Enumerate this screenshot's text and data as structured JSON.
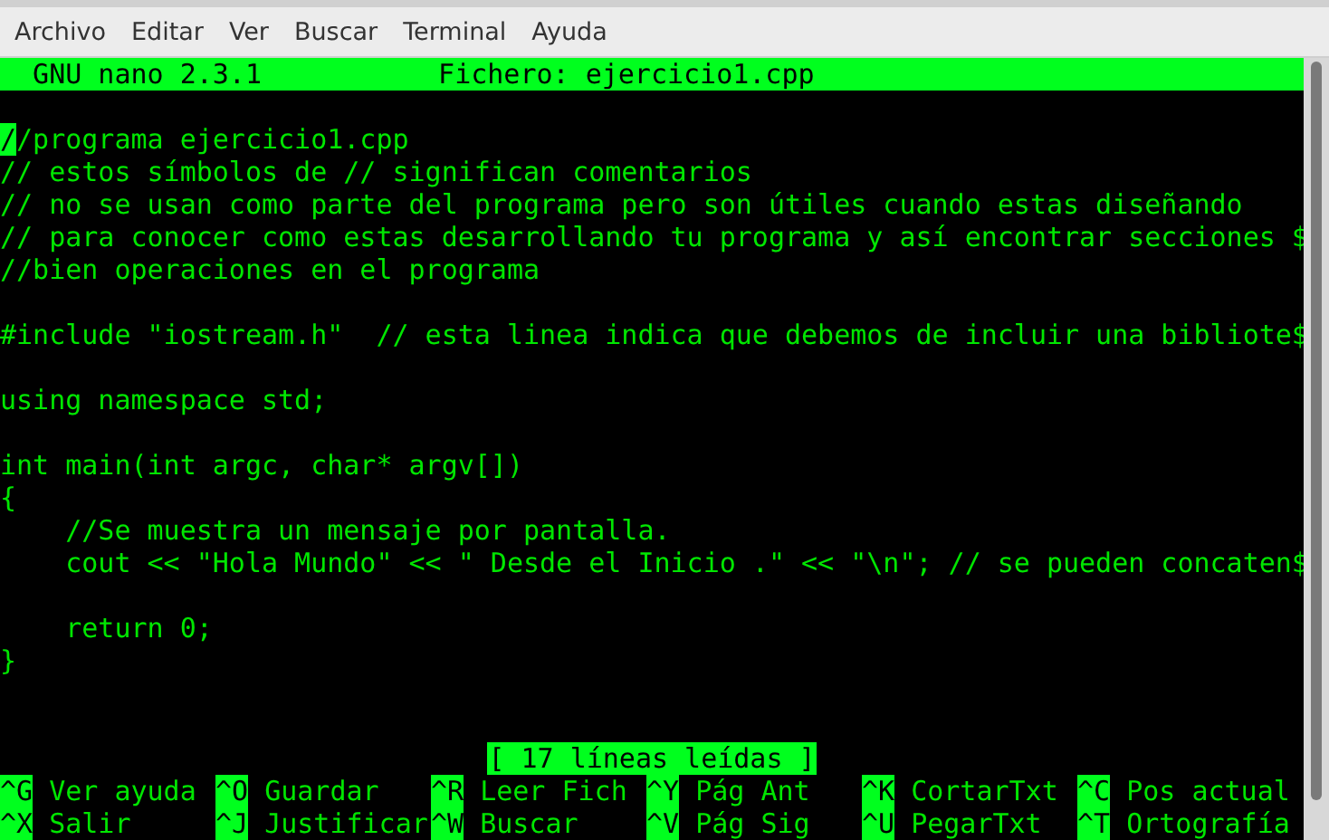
{
  "menu": [
    "Archivo",
    "Editar",
    "Ver",
    "Buscar",
    "Terminal",
    "Ayuda"
  ],
  "title_bar": {
    "version": "GNU nano 2.3.1",
    "file": "Fichero: ejercicio1.cpp"
  },
  "lines": [
    {
      "kind": "code",
      "text": "//programa ejercicio1.cpp",
      "cursor": true
    },
    {
      "kind": "code",
      "text": "// estos símbolos de // significan comentarios",
      "cursor": false
    },
    {
      "kind": "code",
      "text": "// no se usan como parte del programa pero son útiles cuando estas diseñando",
      "cursor": false
    },
    {
      "kind": "code",
      "text": "// para conocer como estas desarrollando tu programa y así encontrar secciones $",
      "cursor": false
    },
    {
      "kind": "code",
      "text": "//bien operaciones en el programa",
      "cursor": false
    },
    {
      "kind": "blank"
    },
    {
      "kind": "code",
      "text": "#include \"iostream.h\"  // esta linea indica que debemos de incluir una bibliote$",
      "cursor": false
    },
    {
      "kind": "blank"
    },
    {
      "kind": "code",
      "text": "using namespace std;",
      "cursor": false
    },
    {
      "kind": "blank"
    },
    {
      "kind": "code",
      "text": "int main(int argc, char* argv[])",
      "cursor": false
    },
    {
      "kind": "code",
      "text": "{",
      "cursor": false
    },
    {
      "kind": "code",
      "text": "    //Se muestra un mensaje por pantalla.",
      "cursor": false
    },
    {
      "kind": "code",
      "text": "    cout << \"Hola Mundo\" << \" Desde el Inicio .\" << \"\\n\"; // se pueden concaten$",
      "cursor": false
    },
    {
      "kind": "blank"
    },
    {
      "kind": "code",
      "text": "    return 0;",
      "cursor": false
    },
    {
      "kind": "code",
      "text": "}",
      "cursor": false
    },
    {
      "kind": "blank"
    },
    {
      "kind": "blank"
    }
  ],
  "status": "[ 17 líneas leídas ]",
  "shortcuts": [
    {
      "key": "^G",
      "label": "Ver ayuda"
    },
    {
      "key": "^O",
      "label": "Guardar"
    },
    {
      "key": "^R",
      "label": "Leer Fich"
    },
    {
      "key": "^Y",
      "label": "Pág Ant"
    },
    {
      "key": "^K",
      "label": "CortarTxt"
    },
    {
      "key": "^C",
      "label": "Pos actual"
    },
    {
      "key": "^X",
      "label": "Salir"
    },
    {
      "key": "^J",
      "label": "Justificar"
    },
    {
      "key": "^W",
      "label": "Buscar"
    },
    {
      "key": "^V",
      "label": "Pág Sig"
    },
    {
      "key": "^U",
      "label": "PegarTxt"
    },
    {
      "key": "^T",
      "label": "Ortografía"
    }
  ]
}
